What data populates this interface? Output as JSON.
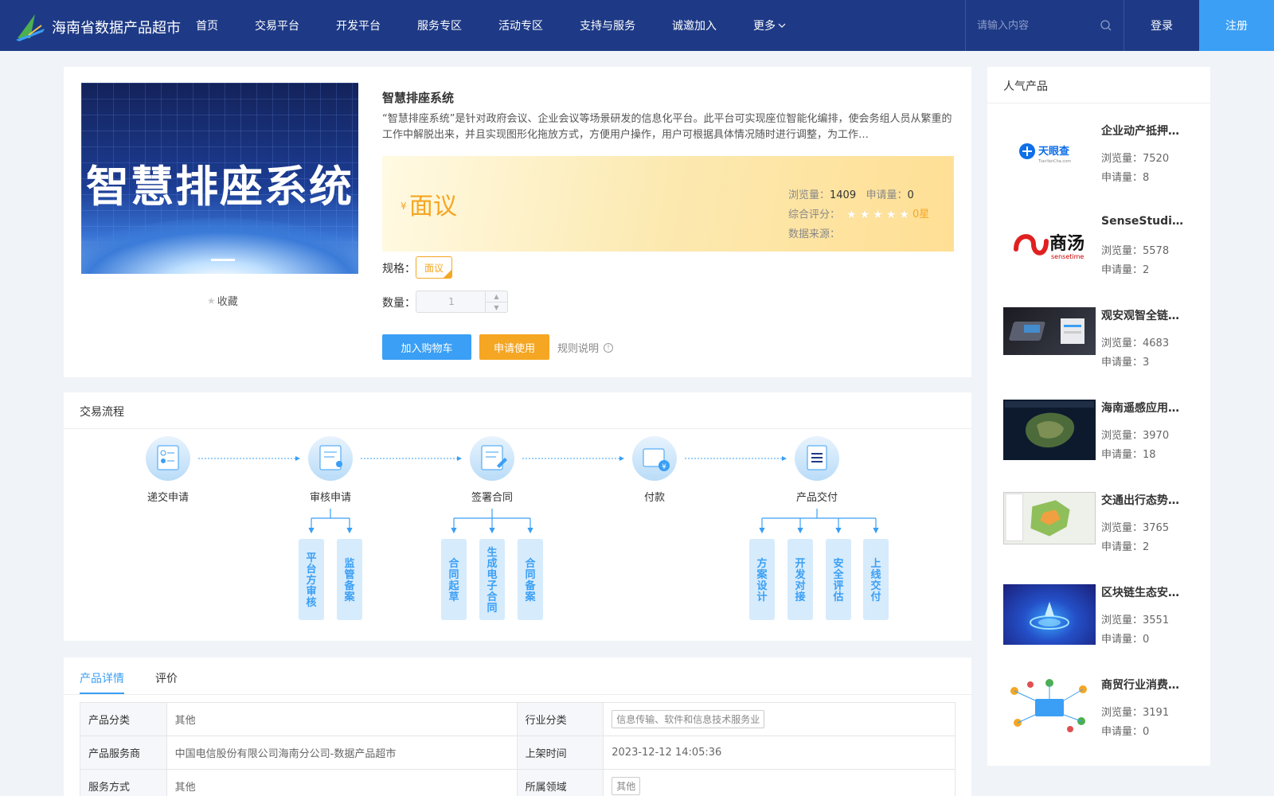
{
  "header": {
    "brand": "海南省数据产品超市",
    "nav": [
      "首页",
      "交易平台",
      "开发平台",
      "服务专区",
      "活动专区",
      "支持与服务",
      "诚邀加入",
      "更多"
    ],
    "search_placeholder": "请输入内容",
    "login": "登录",
    "register": "注册"
  },
  "product": {
    "image_text": "智慧排座系统",
    "favorite": "收藏",
    "title": "智慧排座系统",
    "description": "“智慧排座系统”是针对政府会议、企业会议等场景研发的信息化平台。此平台可实现座位智能化编排，使会务组人员从繁重的工作中解脱出来，并且实现图形化拖放方式，方便用户操作，用户可根据具体情况随时进行调整，为工作…",
    "currency": "¥",
    "price": "面议",
    "views_label": "浏览量：",
    "views": "1409",
    "applies_label": "申请量：",
    "applies": "0",
    "rating_label": "综合评分：",
    "rating": "0星",
    "source_label": "数据来源：",
    "source": "",
    "spec_label": "规格：",
    "spec": "面议",
    "qty_label": "数量：",
    "qty": "1",
    "add_cart": "加入购物车",
    "apply": "申请使用",
    "rules": "规则说明"
  },
  "process": {
    "title": "交易流程",
    "steps": [
      "递交申请",
      "审核申请",
      "签署合同",
      "付款",
      "产品交付"
    ],
    "substeps": [
      "平台方审核",
      "监管备案",
      "合同起草",
      "生成电子合同",
      "合同备案",
      "方案设计",
      "开发对接",
      "安全评估",
      "上线交付"
    ]
  },
  "details": {
    "tabs": [
      "产品详情",
      "评价"
    ],
    "rows": [
      {
        "k1": "产品分类",
        "v1": "其他",
        "k2": "行业分类",
        "v2": "信息传输、软件和信息技术服务业"
      },
      {
        "k1": "产品服务商",
        "v1": "中国电信股份有限公司海南分公司-数据产品超市",
        "k2": "上架时间",
        "v2": "2023-12-12 14:05:36"
      },
      {
        "k1": "服务方式",
        "v1": "其他",
        "k2": "所属领域",
        "v2": "其他"
      }
    ]
  },
  "popular": {
    "title": "人气产品",
    "views_label": "浏览量：",
    "applies_label": "申请量：",
    "items": [
      {
        "name": "企业动产抵押…",
        "views": "7520",
        "applies": "8",
        "logo": "天眼查",
        "logo_sub": "TianYanCha.com"
      },
      {
        "name": "SenseStudio…",
        "views": "5578",
        "applies": "2",
        "logo": "商汤",
        "logo_sub": "sensetime"
      },
      {
        "name": "观安观智全链…",
        "views": "4683",
        "applies": "3"
      },
      {
        "name": "海南遥感应用…",
        "views": "3970",
        "applies": "18"
      },
      {
        "name": "交通出行态势…",
        "views": "3765",
        "applies": "2"
      },
      {
        "name": "区块链生态安…",
        "views": "3551",
        "applies": "0"
      },
      {
        "name": "商贸行业消费…",
        "views": "3191",
        "applies": "0"
      }
    ]
  },
  "colors": {
    "nav_bg": "#1e3a86",
    "accent": "#3a9ff5",
    "orange": "#f5a623"
  }
}
